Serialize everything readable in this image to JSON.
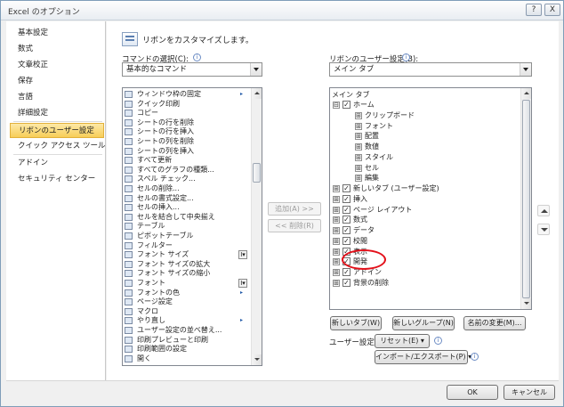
{
  "window": {
    "title": "Excel のオプション",
    "help_glyph": "?",
    "close_glyph": "X"
  },
  "sidebar": {
    "items": [
      {
        "label": "基本設定"
      },
      {
        "label": "数式"
      },
      {
        "label": "文章校正"
      },
      {
        "label": "保存"
      },
      {
        "label": "言語"
      },
      {
        "label": "詳細設定"
      },
      {
        "label": "リボンのユーザー設定",
        "selected": true
      },
      {
        "label": "クイック アクセス ツール バー"
      },
      {
        "label": "アドイン"
      },
      {
        "label": "セキュリティ センター"
      }
    ]
  },
  "main": {
    "header_text": "リボンをカスタマイズします。",
    "commands_label": "コマンドの選択(C):",
    "commands_combo": "基本的なコマンド",
    "ribbon_label": "リボンのユーザー設定(B):",
    "ribbon_combo": "メイン タブ",
    "info_glyph": "i",
    "commands": [
      {
        "label": "ウィンドウ枠の固定",
        "submenu": "▸"
      },
      {
        "label": "クイック印刷"
      },
      {
        "label": "コピー"
      },
      {
        "label": "シートの行を削除"
      },
      {
        "label": "シートの行を挿入"
      },
      {
        "label": "シートの列を削除"
      },
      {
        "label": "シートの列を挿入"
      },
      {
        "label": "すべて更新"
      },
      {
        "label": "すべてのグラフの種類..."
      },
      {
        "label": "スペル チェック..."
      },
      {
        "label": "セルの削除..."
      },
      {
        "label": "セルの書式設定..."
      },
      {
        "label": "セルの挿入..."
      },
      {
        "label": "セルを結合して中央揃え"
      },
      {
        "label": "テーブル"
      },
      {
        "label": "ピボットテーブル"
      },
      {
        "label": "フィルター"
      },
      {
        "label": "フォント サイズ",
        "dropdown": "I▾"
      },
      {
        "label": "フォント サイズの拡大"
      },
      {
        "label": "フォント サイズの縮小"
      },
      {
        "label": "フォント",
        "dropdown": "I▾"
      },
      {
        "label": "フォントの色",
        "submenu": "▸"
      },
      {
        "label": "ページ設定"
      },
      {
        "label": "マクロ"
      },
      {
        "label": "やり直し",
        "submenu": "▸"
      },
      {
        "label": "ユーザー設定の並べ替え..."
      },
      {
        "label": "印刷プレビューと印刷"
      },
      {
        "label": "印刷範囲の設定"
      },
      {
        "label": "開く"
      }
    ],
    "tree_header": "メイン タブ",
    "tree": [
      {
        "label": "ホーム",
        "level": 0,
        "expander": "⊟",
        "checked": true
      },
      {
        "label": "クリップボード",
        "level": 1,
        "expander": "⊞"
      },
      {
        "label": "フォント",
        "level": 1,
        "expander": "⊞"
      },
      {
        "label": "配置",
        "level": 1,
        "expander": "⊞"
      },
      {
        "label": "数値",
        "level": 1,
        "expander": "⊞"
      },
      {
        "label": "スタイル",
        "level": 1,
        "expander": "⊞"
      },
      {
        "label": "セル",
        "level": 1,
        "expander": "⊞"
      },
      {
        "label": "編集",
        "level": 1,
        "expander": "⊞"
      },
      {
        "label": "新しいタブ (ユーザー設定)",
        "level": 0,
        "expander": "⊞",
        "checked": true
      },
      {
        "label": "挿入",
        "level": 0,
        "expander": "⊞",
        "checked": true
      },
      {
        "label": "ページ レイアウト",
        "level": 0,
        "expander": "⊞",
        "checked": true
      },
      {
        "label": "数式",
        "level": 0,
        "expander": "⊞",
        "checked": true
      },
      {
        "label": "データ",
        "level": 0,
        "expander": "⊞",
        "checked": true
      },
      {
        "label": "校閲",
        "level": 0,
        "expander": "⊞",
        "checked": true
      },
      {
        "label": "表示",
        "level": 0,
        "expander": "⊞",
        "checked": true
      },
      {
        "label": "開発",
        "level": 0,
        "expander": "⊞",
        "checked": true,
        "highlighted": true
      },
      {
        "label": "アドイン",
        "level": 0,
        "expander": "⊞",
        "checked": true
      },
      {
        "label": "背景の削除",
        "level": 0,
        "expander": "⊞",
        "checked": true
      }
    ],
    "add_button": "追加(A) >>",
    "remove_button": "<< 削除(R)",
    "new_tab_button": "新しいタブ(W)",
    "new_group_button": "新しいグループ(N)",
    "rename_button": "名前の変更(M)...",
    "customize_label": "ユーザー設定:",
    "reset_button": "リセット(E) ▾",
    "import_export_button": "インポート/エクスポート(P) ▾"
  },
  "footer": {
    "ok": "OK",
    "cancel": "キャンセル"
  },
  "colors": {
    "selected_sidebar": "#f7cd58",
    "highlight_circle": "#e3101a",
    "window_border": "#7f9db9"
  }
}
